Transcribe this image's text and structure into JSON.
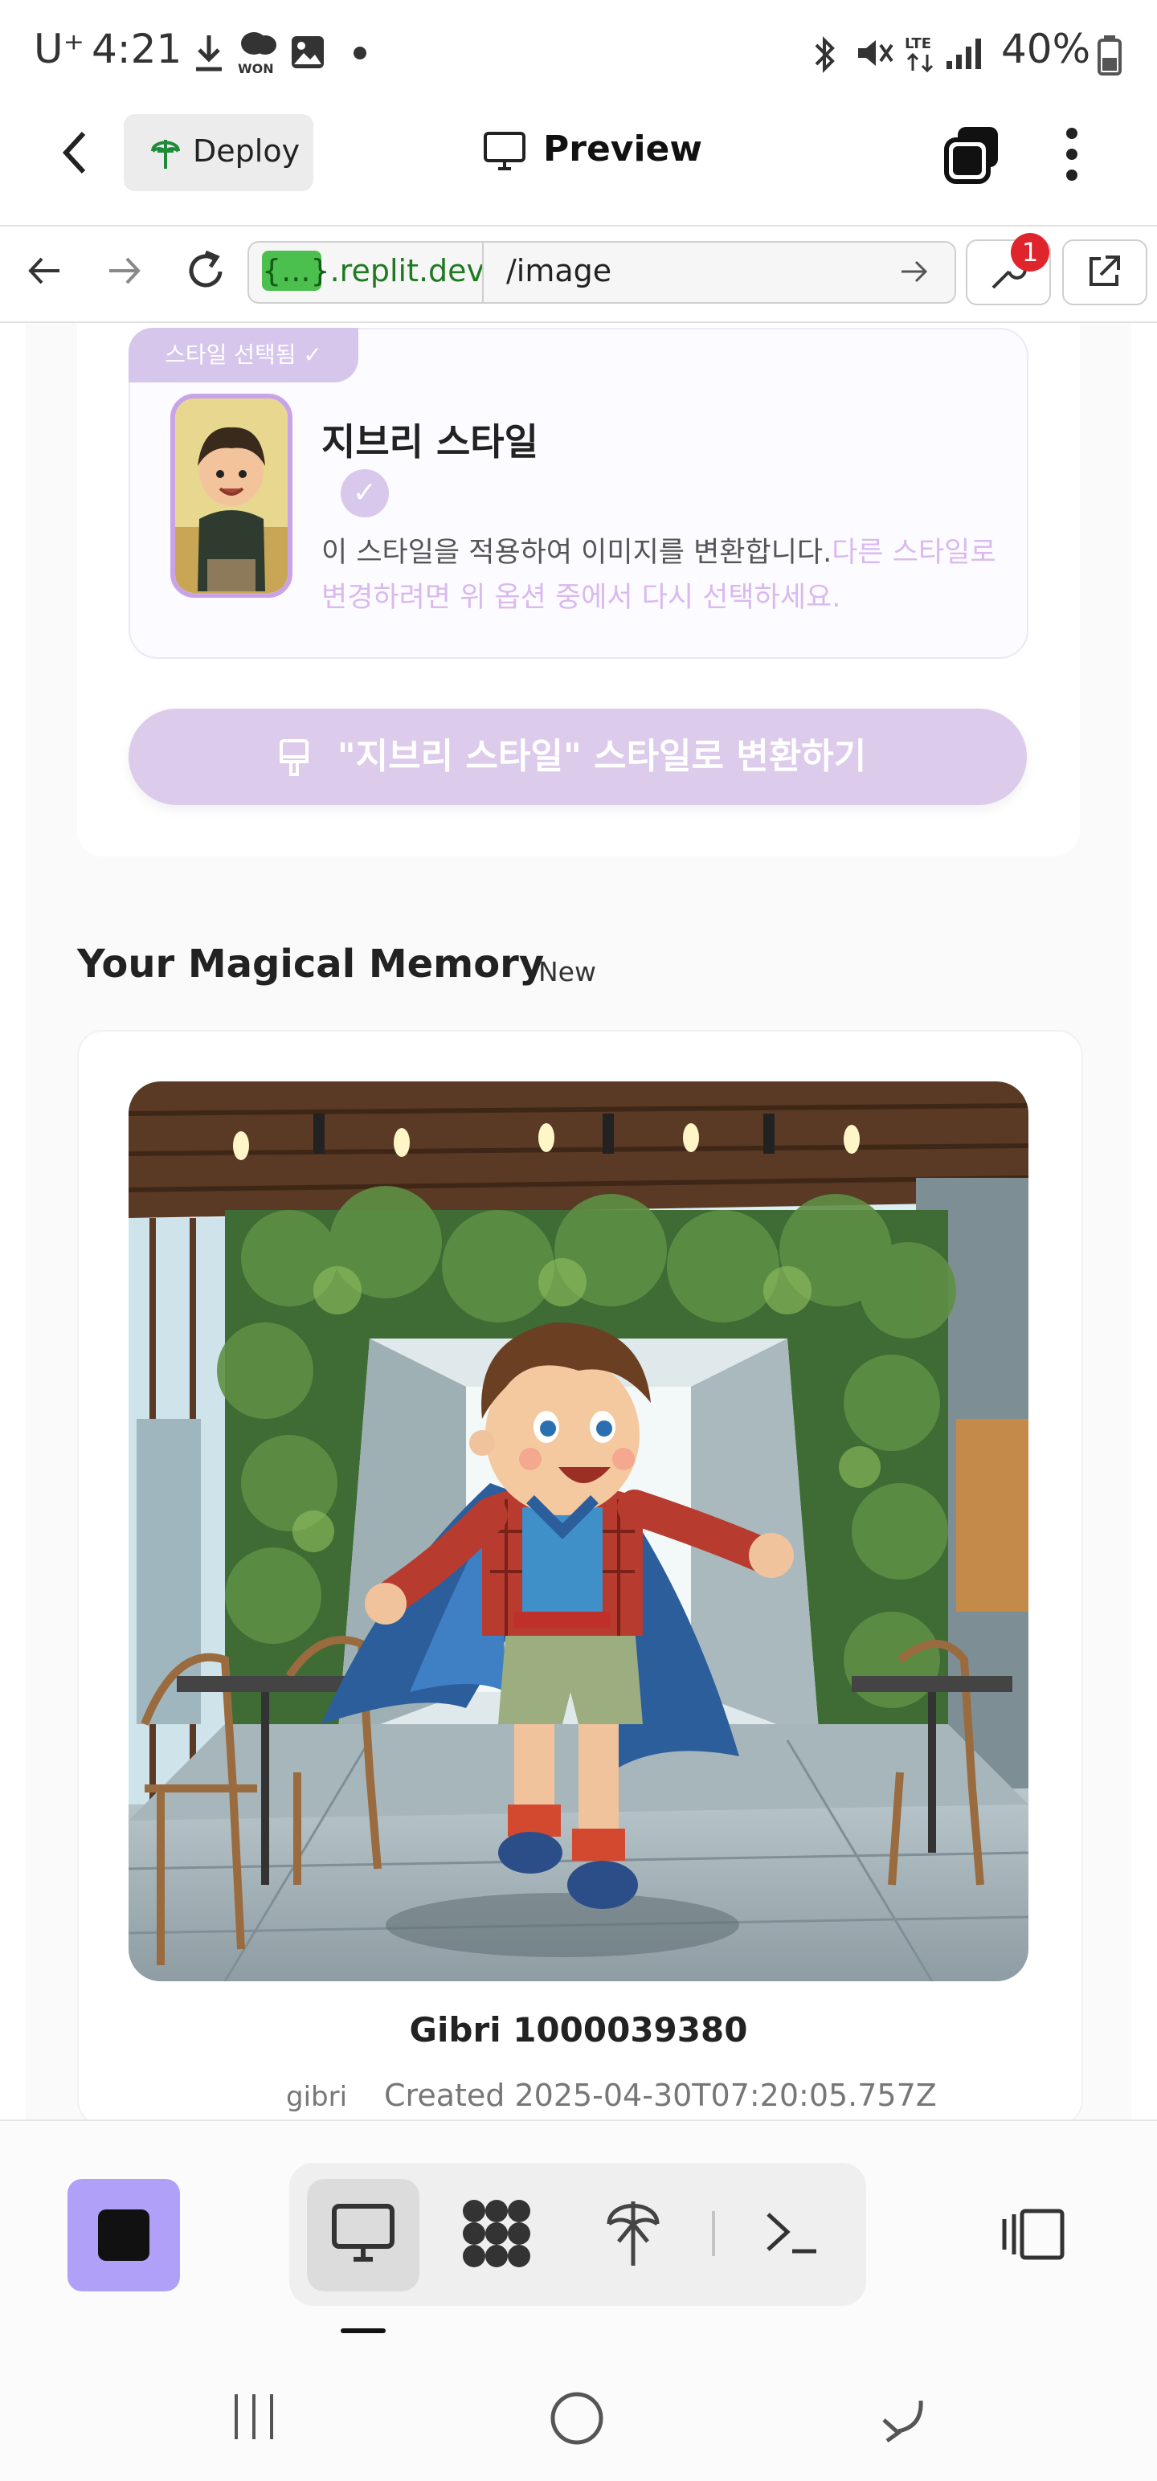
{
  "status_bar": {
    "carrier": "U⁺",
    "time": "4:21",
    "won_label": "WON",
    "battery": "40%"
  },
  "top_bar": {
    "deploy_label": "Deploy",
    "preview_label": "Preview"
  },
  "url_bar": {
    "domain_chip": "{...}",
    "domain": ".replit.dev",
    "path": "/image",
    "badge_count": "1"
  },
  "style_panel": {
    "selected_tag": "스타일 선택됨 ✓",
    "title": "지브리 스타일",
    "check": "✓",
    "description": "이 스타일을 적용하여 이미지를 변환합니다.",
    "description_hint": "다른 스타일로 변경하려면 위 옵션 중에서 다시 선택하세요.",
    "convert_button": "\"지브리 스타일\" 스타일로 변환하기"
  },
  "memory": {
    "section_title": "Your Magical Memory",
    "new_tag": "New",
    "image_title": "Gibri 1000039380",
    "tag": "gibri",
    "created": "Created 2025-04-30T07:20:05.757Z"
  },
  "colors": {
    "accent_purple": "#dccbeb",
    "stop_button": "#b0a0f8",
    "domain_chip": "#4bc04f",
    "badge": "#e0242c"
  },
  "icons": [
    "back-icon",
    "deploy-icon",
    "monitor-icon",
    "tabs-icon",
    "more-icon",
    "nav-back-icon",
    "nav-forward-icon",
    "reload-icon",
    "go-arrow-icon",
    "wrench-icon",
    "external-link-icon",
    "paintbrush-icon",
    "stop-icon",
    "webview-icon",
    "workspace-icon",
    "deploy-tool-icon",
    "console-icon",
    "sidebar-toggle-icon",
    "recents-nav-icon",
    "home-nav-icon",
    "back-nav-icon"
  ]
}
